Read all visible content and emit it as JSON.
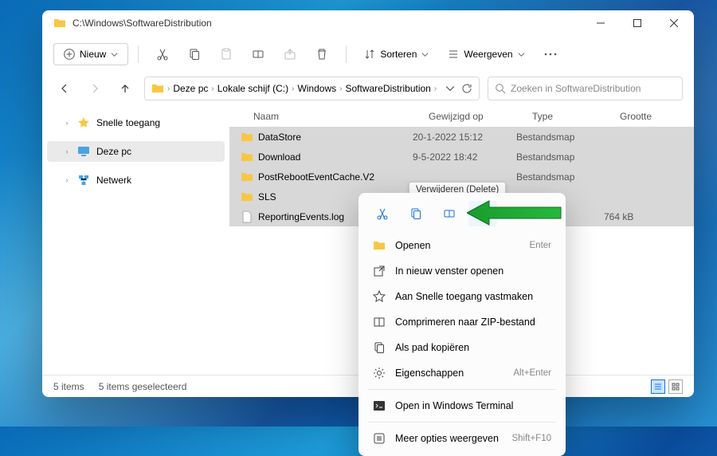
{
  "window": {
    "title": "C:\\Windows\\SoftwareDistribution"
  },
  "toolbar": {
    "new_label": "Nieuw",
    "sort_label": "Sorteren",
    "view_label": "Weergeven"
  },
  "breadcrumb": {
    "items": [
      "Deze pc",
      "Lokale schijf (C:)",
      "Windows",
      "SoftwareDistribution"
    ]
  },
  "search": {
    "placeholder": "Zoeken in SoftwareDistribution"
  },
  "sidebar": {
    "items": [
      {
        "label": "Snelle toegang"
      },
      {
        "label": "Deze pc"
      },
      {
        "label": "Netwerk"
      }
    ]
  },
  "columns": {
    "name": "Naam",
    "modified": "Gewijzigd op",
    "type": "Type",
    "size": "Grootte"
  },
  "rows": [
    {
      "name": "DataStore",
      "modified": "20-1-2022 15:12",
      "type": "Bestandsmap",
      "size": "",
      "icon": "folder"
    },
    {
      "name": "Download",
      "modified": "9-5-2022 18:42",
      "type": "Bestandsmap",
      "size": "",
      "icon": "folder"
    },
    {
      "name": "PostRebootEventCache.V2",
      "modified": "",
      "type": "Bestandsmap",
      "size": "",
      "icon": "folder"
    },
    {
      "name": "SLS",
      "modified": "",
      "type": "",
      "size": "",
      "icon": "folder"
    },
    {
      "name": "ReportingEvents.log",
      "modified": "",
      "type": "",
      "size": "764 kB",
      "icon": "file"
    }
  ],
  "statusbar": {
    "count": "5 items",
    "selected": "5 items geselecteerd"
  },
  "tooltip": "Verwijderen (Delete)",
  "context_menu": {
    "items": [
      {
        "label": "Openen",
        "accel": "Enter",
        "icon": "folder"
      },
      {
        "label": "In nieuw venster openen",
        "accel": "",
        "icon": "open-new"
      },
      {
        "label": "Aan Snelle toegang vastmaken",
        "accel": "",
        "icon": "pin"
      },
      {
        "label": "Comprimeren naar ZIP-bestand",
        "accel": "",
        "icon": "zip"
      },
      {
        "label": "Als pad kopiëren",
        "accel": "",
        "icon": "copy-path"
      },
      {
        "label": "Eigenschappen",
        "accel": "Alt+Enter",
        "icon": "properties"
      }
    ],
    "terminal": "Open in Windows Terminal",
    "more": "Meer opties weergeven",
    "more_accel": "Shift+F10"
  }
}
